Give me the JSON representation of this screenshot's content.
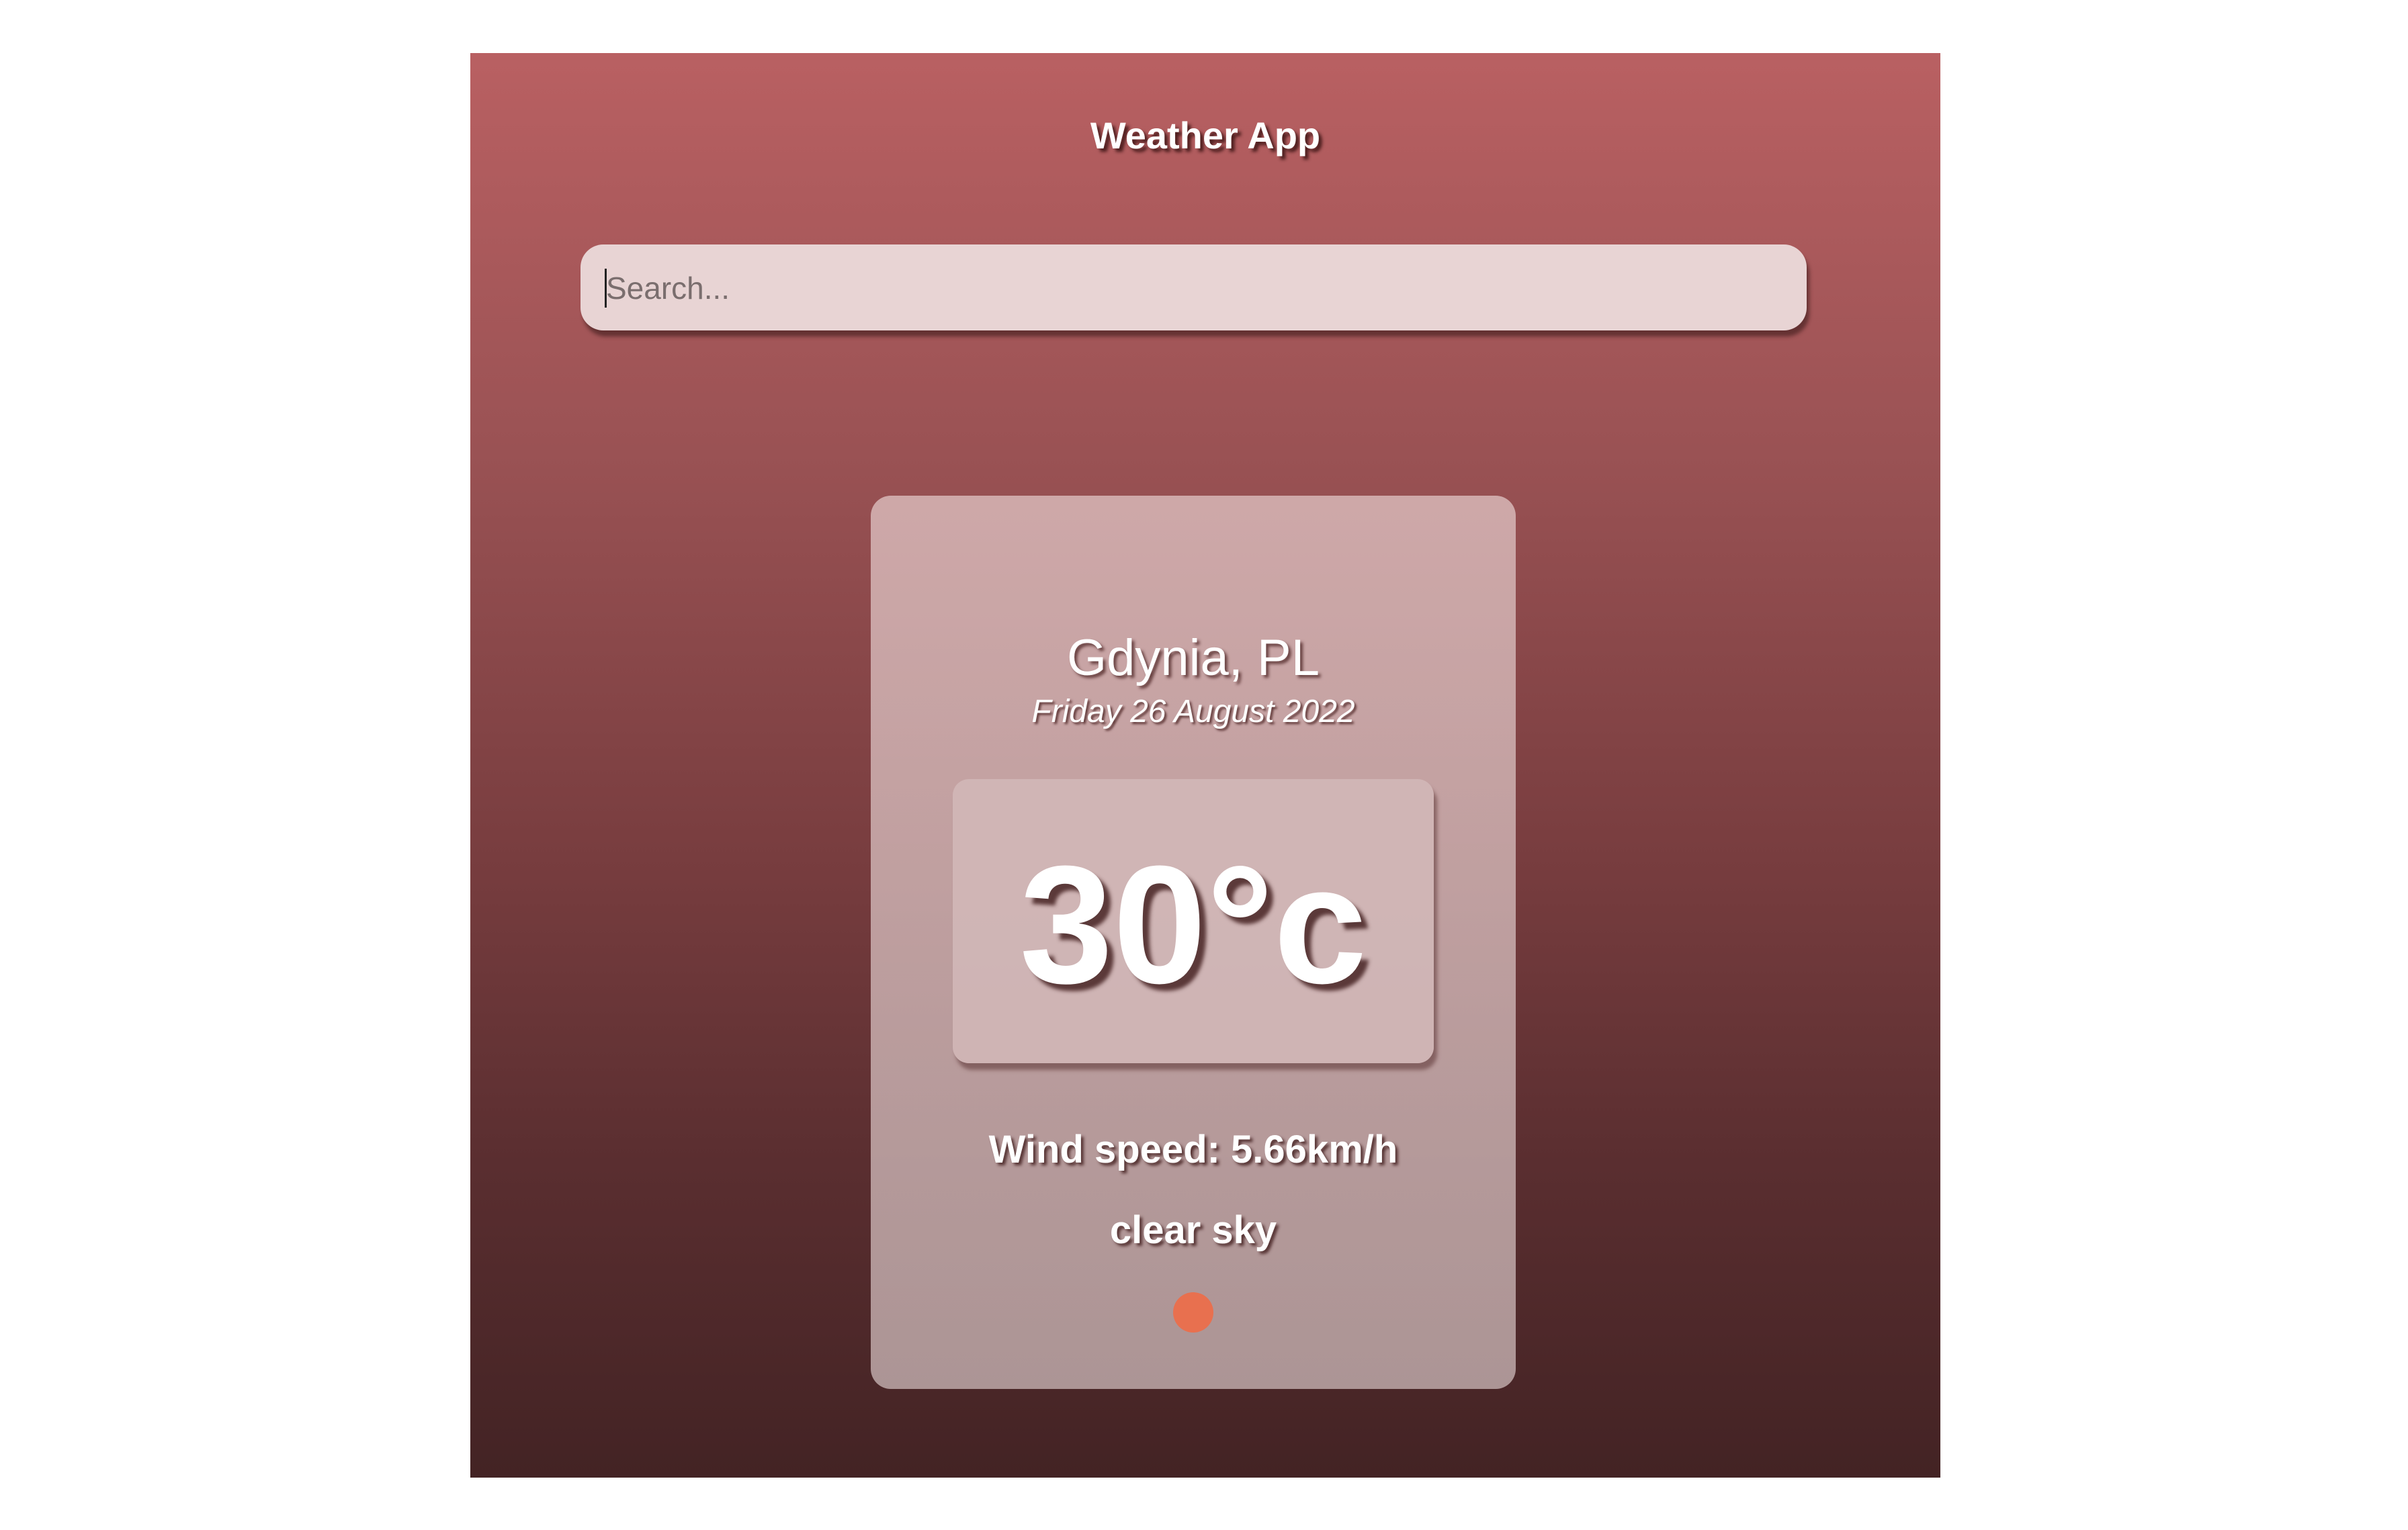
{
  "app": {
    "title": "Weather App"
  },
  "search": {
    "placeholder": "Search...",
    "value": ""
  },
  "weather": {
    "location": "Gdynia, PL",
    "date": "Friday 26 August 2022",
    "temperature": "30°c",
    "wind": "Wind speed: 5.66km/h",
    "description": "clear sky",
    "icon": "sun-icon",
    "icon_color": "#e8704f"
  },
  "colors": {
    "background_top": "#b96062",
    "background_bottom": "#432324",
    "search_bg": "#e8d4d4"
  }
}
